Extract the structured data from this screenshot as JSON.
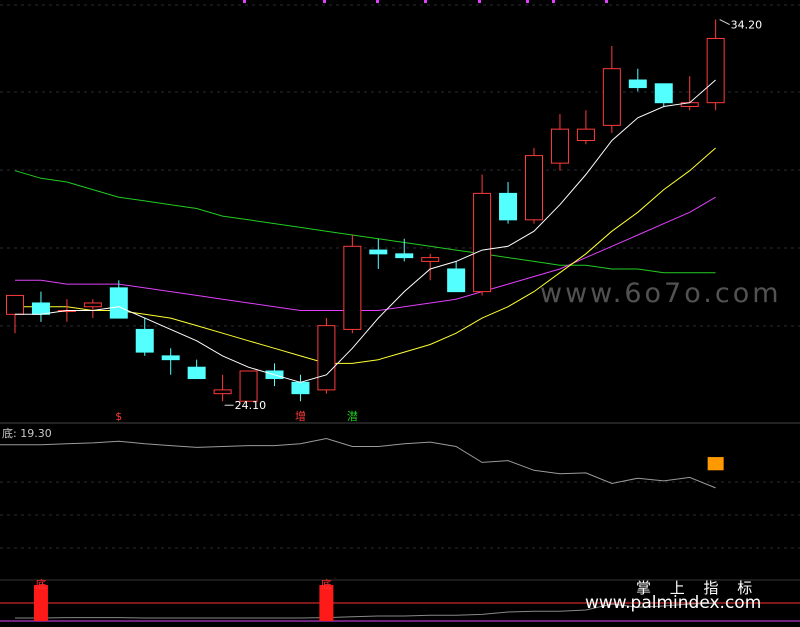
{
  "chart_data": [
    {
      "type": "candlestick",
      "panel": "main",
      "colors": {
        "up": "#ff3b3b",
        "down": "#54ffff",
        "ma5": "#ffffff",
        "ma10": "#ffff33",
        "ma20": "#e040fb",
        "ma60": "#22cc22"
      },
      "candles": [
        {
          "o": 26.4,
          "h": 26.7,
          "l": 25.9,
          "c": 26.9
        },
        {
          "o": 26.7,
          "h": 27.0,
          "l": 26.2,
          "c": 26.4
        },
        {
          "o": 26.5,
          "h": 26.8,
          "l": 26.2,
          "c": 26.5
        },
        {
          "o": 26.6,
          "h": 26.8,
          "l": 26.3,
          "c": 26.7
        },
        {
          "o": 27.1,
          "h": 27.3,
          "l": 26.3,
          "c": 26.3
        },
        {
          "o": 26.0,
          "h": 26.3,
          "l": 25.3,
          "c": 25.4
        },
        {
          "o": 25.3,
          "h": 25.5,
          "l": 24.8,
          "c": 25.2
        },
        {
          "o": 25.0,
          "h": 25.2,
          "l": 24.7,
          "c": 24.7
        },
        {
          "o": 24.3,
          "h": 24.8,
          "l": 24.1,
          "c": 24.4
        },
        {
          "o": 24.1,
          "h": 24.9,
          "l": 24.1,
          "c": 24.9
        },
        {
          "o": 24.9,
          "h": 25.1,
          "l": 24.5,
          "c": 24.7
        },
        {
          "o": 24.6,
          "h": 24.8,
          "l": 24.1,
          "c": 24.3
        },
        {
          "o": 24.4,
          "h": 26.3,
          "l": 24.3,
          "c": 26.1
        },
        {
          "o": 26.0,
          "h": 28.5,
          "l": 25.9,
          "c": 28.2
        },
        {
          "o": 28.1,
          "h": 28.4,
          "l": 27.6,
          "c": 28.0
        },
        {
          "o": 28.0,
          "h": 28.4,
          "l": 27.8,
          "c": 27.9
        },
        {
          "o": 27.8,
          "h": 28.0,
          "l": 27.3,
          "c": 27.9
        },
        {
          "o": 27.6,
          "h": 27.8,
          "l": 27.0,
          "c": 27.0
        },
        {
          "o": 27.0,
          "h": 30.1,
          "l": 26.9,
          "c": 29.6
        },
        {
          "o": 29.6,
          "h": 29.9,
          "l": 28.8,
          "c": 28.9
        },
        {
          "o": 28.9,
          "h": 30.8,
          "l": 28.8,
          "c": 30.6
        },
        {
          "o": 30.4,
          "h": 31.7,
          "l": 30.2,
          "c": 31.3
        },
        {
          "o": 31.0,
          "h": 31.8,
          "l": 30.9,
          "c": 31.3
        },
        {
          "o": 31.4,
          "h": 33.5,
          "l": 31.2,
          "c": 32.9
        },
        {
          "o": 32.6,
          "h": 32.9,
          "l": 32.3,
          "c": 32.4
        },
        {
          "o": 32.5,
          "h": 32.5,
          "l": 31.9,
          "c": 32.0
        },
        {
          "o": 31.9,
          "h": 32.7,
          "l": 31.8,
          "c": 32.0
        },
        {
          "o": 32.0,
          "h": 34.2,
          "l": 31.8,
          "c": 33.7
        }
      ],
      "ma5": [
        26.4,
        26.4,
        26.5,
        26.5,
        26.6,
        26.3,
        26.0,
        25.7,
        25.3,
        25.0,
        24.8,
        24.6,
        24.8,
        25.5,
        26.3,
        27.0,
        27.6,
        27.8,
        28.1,
        28.2,
        28.6,
        29.3,
        30.1,
        31.0,
        31.6,
        31.9,
        32.0,
        32.6
      ],
      "ma10": [
        26.6,
        26.6,
        26.6,
        26.5,
        26.5,
        26.4,
        26.3,
        26.1,
        25.9,
        25.7,
        25.5,
        25.3,
        25.1,
        25.1,
        25.2,
        25.4,
        25.6,
        25.9,
        26.3,
        26.6,
        27.0,
        27.5,
        28.0,
        28.6,
        29.1,
        29.7,
        30.2,
        30.8
      ],
      "ma20": [
        27.3,
        27.3,
        27.2,
        27.2,
        27.2,
        27.1,
        27.0,
        26.9,
        26.8,
        26.7,
        26.6,
        26.5,
        26.5,
        26.5,
        26.5,
        26.6,
        26.7,
        26.8,
        27.0,
        27.2,
        27.4,
        27.6,
        27.9,
        28.2,
        28.5,
        28.8,
        29.1,
        29.5
      ],
      "ma60": [
        30.2,
        30.0,
        29.9,
        29.7,
        29.5,
        29.4,
        29.3,
        29.2,
        29.0,
        28.9,
        28.8,
        28.7,
        28.6,
        28.5,
        28.4,
        28.3,
        28.2,
        28.1,
        28.0,
        27.9,
        27.8,
        27.7,
        27.7,
        27.6,
        27.6,
        27.5,
        27.5,
        27.5
      ],
      "ylim": [
        24.0,
        34.4
      ],
      "annotations": {
        "high": {
          "index": 27,
          "label": "34.20"
        },
        "low": {
          "index": 8,
          "label": "24.10"
        },
        "markers": [
          {
            "index": 4,
            "text": "$",
            "color": "#ff3b3b"
          },
          {
            "index": 11,
            "text": "增",
            "color": "#ff3b3b"
          },
          {
            "index": 13,
            "text": "潜",
            "color": "#22cc22"
          }
        ]
      },
      "watermark": "www.6o7o.com"
    },
    {
      "type": "line",
      "panel": "indicator",
      "indicator_name": "底",
      "indicator_value": "19.30",
      "values": [
        19.2,
        19.2,
        19.3,
        19.4,
        19.6,
        19.3,
        19.1,
        18.9,
        19.0,
        19.1,
        19.1,
        19.3,
        19.9,
        19.0,
        19.0,
        19.3,
        19.5,
        19.0,
        17.2,
        17.4,
        16.3,
        15.9,
        16.0,
        14.8,
        15.4,
        15.1,
        15.5,
        14.3
      ],
      "bar": {
        "index": 27,
        "value": 17.8,
        "color": "#ff9900"
      },
      "ylim": [
        5.0,
        22.0
      ]
    },
    {
      "type": "bar",
      "panel": "bottom",
      "labels": [
        {
          "index": 1,
          "text": "底"
        },
        {
          "index": 12,
          "text": "底"
        }
      ],
      "values": [
        0,
        1,
        0,
        0,
        0,
        0,
        0,
        0,
        0,
        0,
        0,
        0,
        1,
        0,
        0,
        0,
        0,
        0,
        0,
        0,
        0,
        0,
        0,
        0,
        0,
        0,
        0,
        0
      ],
      "line_values": [
        0.05,
        0.05,
        0.06,
        0.06,
        0.06,
        0.05,
        0.05,
        0.05,
        0.05,
        0.05,
        0.05,
        0.05,
        0.06,
        0.08,
        0.1,
        0.1,
        0.12,
        0.12,
        0.14,
        0.2,
        0.22,
        0.22,
        0.25,
        0.4,
        0.32,
        0.35,
        0.4,
        0.42
      ],
      "brand_text": "掌 上 指 标",
      "brand_url": "www.palmindex.com"
    }
  ]
}
